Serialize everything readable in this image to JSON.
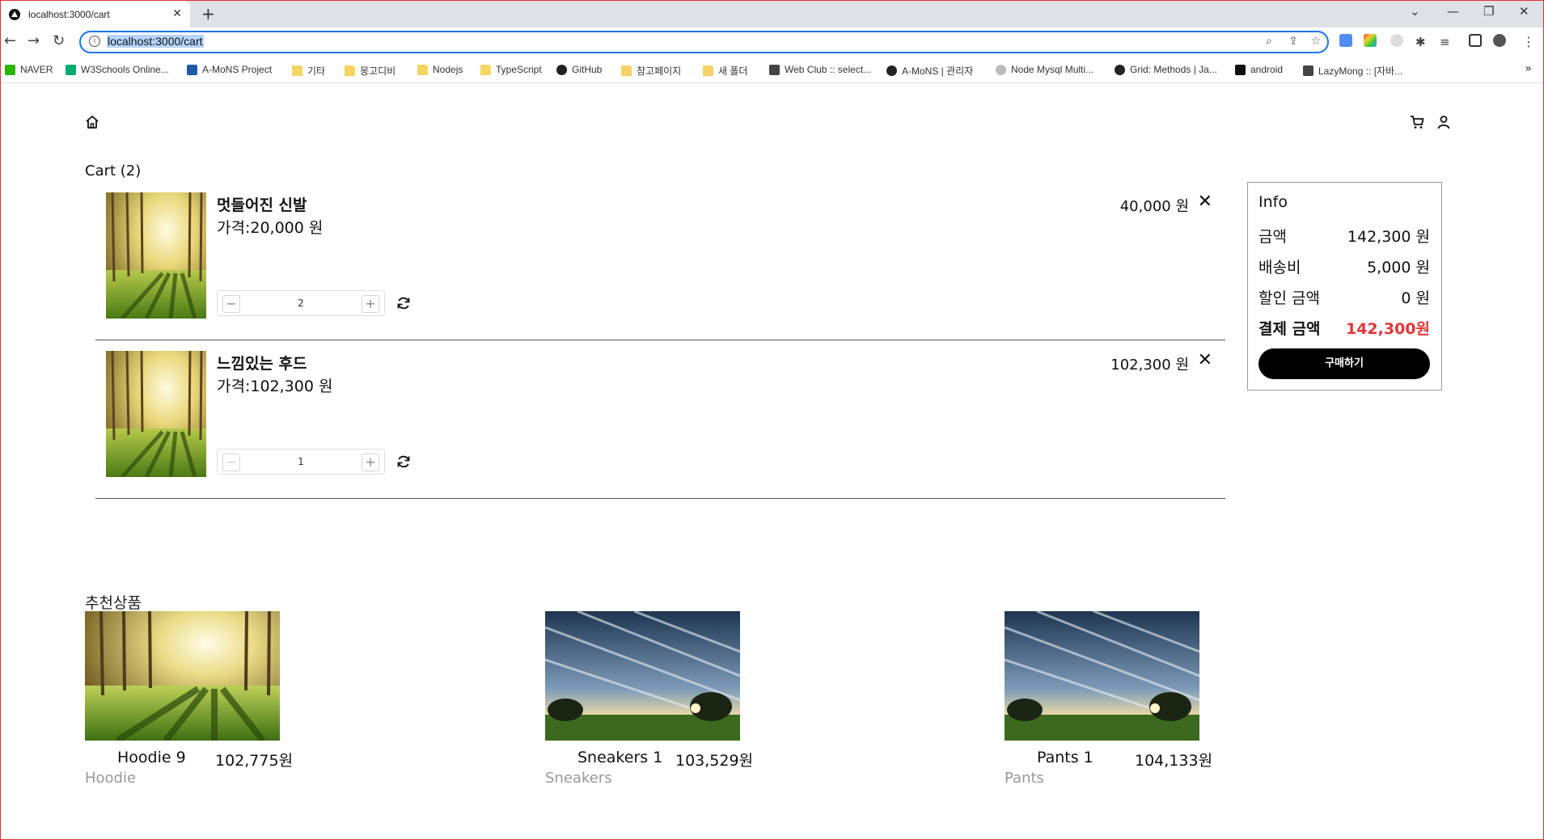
{
  "browser": {
    "tab_title": "localhost:3000/cart",
    "tab_close": "✕",
    "new_tab": "+",
    "url": "localhost:3000/cart",
    "bookmarks": [
      {
        "label": "NAVER",
        "icon": "naver-icon"
      },
      {
        "label": "W3Schools Online...",
        "icon": "w3schools-icon"
      },
      {
        "label": "A-MoNS Project",
        "icon": "drive-icon"
      },
      {
        "label": "기타",
        "icon": "folder-icon"
      },
      {
        "label": "몽고디비",
        "icon": "folder-icon"
      },
      {
        "label": "Nodejs",
        "icon": "folder-icon"
      },
      {
        "label": "TypeScript",
        "icon": "folder-icon"
      },
      {
        "label": "GitHub",
        "icon": "github-icon"
      },
      {
        "label": "참고페이지",
        "icon": "folder-icon"
      },
      {
        "label": "새 폴더",
        "icon": "folder-icon"
      },
      {
        "label": "Web Club :: select...",
        "icon": "site-icon"
      },
      {
        "label": "A-MoNS | 관리자",
        "icon": "site-icon"
      },
      {
        "label": "Node Mysql Multi...",
        "icon": "site-icon"
      },
      {
        "label": "Grid: Methods | Ja...",
        "icon": "site-icon"
      },
      {
        "label": "android",
        "icon": "site-icon"
      },
      {
        "label": "LazyMong :: [자바...",
        "icon": "site-icon"
      }
    ],
    "more": "»"
  },
  "cart": {
    "title": "Cart (2)",
    "items": [
      {
        "name": "멋들어진 신발",
        "price": "가격:20,000 원",
        "total": "40,000 원",
        "qty": "2",
        "remove": "✕"
      },
      {
        "name": "느낌있는 후드",
        "price": "가격:102,300 원",
        "total": "102,300 원",
        "qty": "1",
        "remove": "✕"
      }
    ],
    "minus": "−",
    "plus": "+"
  },
  "info": {
    "title": "Info",
    "rows": [
      {
        "label": "금액",
        "value": "142,300 원"
      },
      {
        "label": "배송비",
        "value": "5,000 원"
      },
      {
        "label": "할인 금액",
        "value": "0 원"
      },
      {
        "label": "결제 금액",
        "value": "142,300원"
      }
    ],
    "buy_label": "구매하기"
  },
  "recommend": {
    "title": "추천상품",
    "items": [
      {
        "name": "Hoodie 9",
        "price": "102,775원",
        "category": "Hoodie",
        "image": "forest"
      },
      {
        "name": "Sneakers 1",
        "price": "103,529원",
        "category": "Sneakers",
        "image": "sky"
      },
      {
        "name": "Pants 1",
        "price": "104,133원",
        "category": "Pants",
        "image": "sky"
      }
    ]
  },
  "colors": {
    "accent": "#e23636",
    "button": "#000000",
    "omnibox_border": "#1a73e8"
  }
}
